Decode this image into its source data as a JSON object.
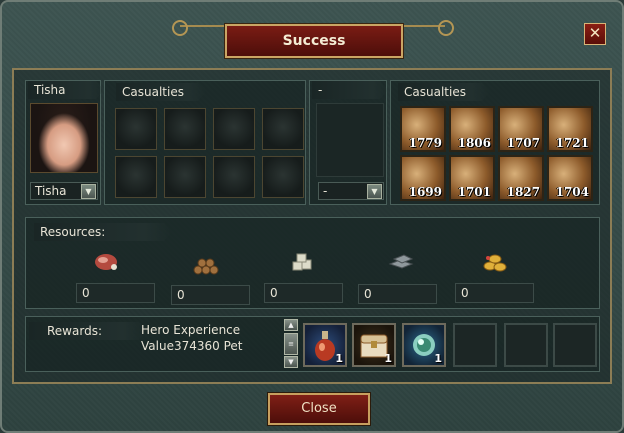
{
  "dialog": {
    "title": "Success",
    "close_glyph": "✕",
    "close_button_label": "Close"
  },
  "left": {
    "hero_name": "Tisha",
    "casualties_label": "Casualties",
    "hero_select_value": "Tisha"
  },
  "middle": {
    "label": "-",
    "select_value": "-"
  },
  "right": {
    "casualties_label": "Casualties",
    "units": [
      {
        "count": "1779"
      },
      {
        "count": "1806"
      },
      {
        "count": "1707"
      },
      {
        "count": "1721"
      },
      {
        "count": "1699"
      },
      {
        "count": "1701"
      },
      {
        "count": "1827"
      },
      {
        "count": "1704"
      }
    ]
  },
  "resources": {
    "label": "Resources:",
    "items": [
      {
        "icon": "meat-icon",
        "value": "0"
      },
      {
        "icon": "wood-icon",
        "value": "0"
      },
      {
        "icon": "stone-icon",
        "value": "0"
      },
      {
        "icon": "iron-icon",
        "value": "0"
      },
      {
        "icon": "gold-icon",
        "value": "0"
      }
    ]
  },
  "rewards": {
    "label": "Rewards:",
    "text_line1": "Hero Experience",
    "text_line2": "Value374360 Pet",
    "items": [
      {
        "icon": "potion-icon",
        "count": "1"
      },
      {
        "icon": "treasure-chest-icon",
        "count": "1"
      },
      {
        "icon": "orb-icon",
        "count": "1"
      }
    ],
    "scroll_up": "▲",
    "scroll_mid": "≡",
    "scroll_down": "▼"
  },
  "colors": {
    "title_red": "#6a1710",
    "gold_border": "#caa564",
    "panel_bg": "#2e423f"
  }
}
